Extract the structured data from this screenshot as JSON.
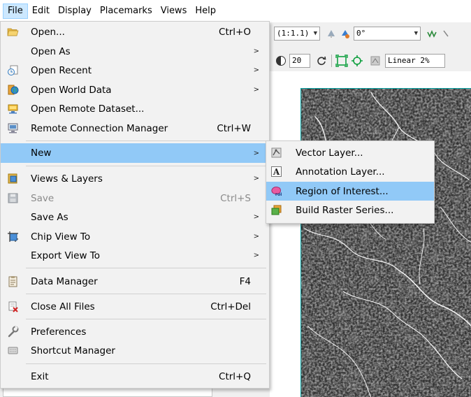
{
  "menubar": {
    "items": [
      {
        "label": "File"
      },
      {
        "label": "Edit"
      },
      {
        "label": "Display"
      },
      {
        "label": "Placemarks"
      },
      {
        "label": "Views"
      },
      {
        "label": "Help"
      }
    ]
  },
  "toolbar": {
    "zoom_value": "(1:1.1)",
    "rotation_value": "0°",
    "brightness_value": "20",
    "stretch_value": "Linear 2%"
  },
  "file_menu": {
    "items": [
      {
        "label": "Open...",
        "shortcut": "Ctrl+O",
        "icon": "folder-open-icon"
      },
      {
        "label": "Open As",
        "submenu": true
      },
      {
        "label": "Open Recent",
        "submenu": true,
        "icon": "recent-files-icon"
      },
      {
        "label": "Open World Data",
        "submenu": true,
        "icon": "world-data-icon"
      },
      {
        "label": "Open Remote Dataset...",
        "icon": "remote-dataset-icon"
      },
      {
        "label": "Remote Connection Manager",
        "shortcut": "Ctrl+W",
        "icon": "remote-connection-icon"
      },
      {
        "label": "New",
        "submenu": true
      },
      {
        "label": "Views & Layers",
        "submenu": true,
        "icon": "views-layers-icon"
      },
      {
        "label": "Save",
        "shortcut": "Ctrl+S",
        "disabled": true,
        "icon": "save-icon"
      },
      {
        "label": "Save As",
        "submenu": true
      },
      {
        "label": "Chip View To",
        "submenu": true,
        "icon": "chip-view-icon"
      },
      {
        "label": "Export View To",
        "submenu": true
      },
      {
        "label": "Data Manager",
        "shortcut": "F4",
        "icon": "data-manager-icon"
      },
      {
        "label": "Close All Files",
        "shortcut": "Ctrl+Del",
        "icon": "close-files-icon"
      },
      {
        "label": "Preferences",
        "icon": "preferences-icon"
      },
      {
        "label": "Shortcut Manager",
        "icon": "keyboard-icon"
      },
      {
        "label": "Exit",
        "shortcut": "Ctrl+Q"
      }
    ]
  },
  "new_menu": {
    "items": [
      {
        "label": "Vector Layer...",
        "icon": "vector-layer-icon"
      },
      {
        "label": "Annotation Layer...",
        "icon": "annotation-layer-icon"
      },
      {
        "label": "Region of Interest...",
        "icon": "roi-icon",
        "icon_text": "roi"
      },
      {
        "label": "Build Raster Series...",
        "icon": "raster-series-icon"
      }
    ]
  },
  "colors": {
    "menu_highlight": "#91c9f7",
    "menu_bg": "#f2f2f2",
    "image_border": "#00a0a0"
  }
}
